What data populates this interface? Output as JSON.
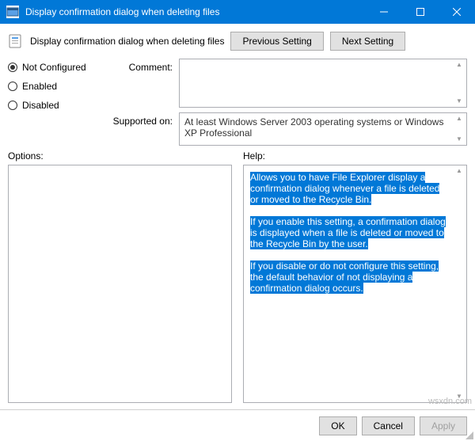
{
  "titlebar": {
    "title": "Display confirmation dialog when deleting files"
  },
  "header": {
    "policy_title": "Display confirmation dialog when deleting files",
    "prev_btn": "Previous Setting",
    "next_btn": "Next Setting"
  },
  "state": {
    "not_configured": "Not Configured",
    "enabled": "Enabled",
    "disabled": "Disabled",
    "selected": "not_configured"
  },
  "fields": {
    "comment_label": "Comment:",
    "comment_value": "",
    "supported_label": "Supported on:",
    "supported_value": "At least Windows Server 2003 operating systems or Windows XP Professional"
  },
  "panels": {
    "options_label": "Options:",
    "help_label": "Help:",
    "help_paras": [
      "Allows you to have File Explorer display a confirmation dialog  whenever a file is deleted or moved to the Recycle Bin.",
      "If you enable this setting, a confirmation dialog is displayed when a file is deleted or moved to the Recycle Bin by the user.",
      "If you disable or do not configure this setting, the default behavior of not displaying a confirmation dialog occurs."
    ]
  },
  "footer": {
    "ok": "OK",
    "cancel": "Cancel",
    "apply": "Apply"
  },
  "watermark": "wsxdn.com"
}
